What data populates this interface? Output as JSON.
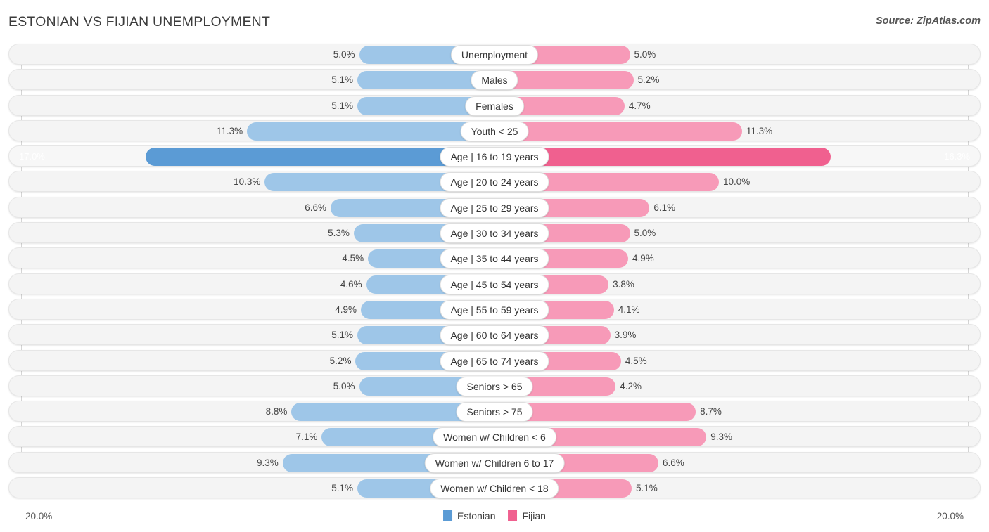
{
  "header": {
    "title": "ESTONIAN VS FIJIAN UNEMPLOYMENT",
    "source": "Source: ZipAtlas.com"
  },
  "footer": {
    "axis_start": "20.0%",
    "axis_end": "20.0%",
    "legend": [
      {
        "label": "Estonian",
        "color": "#5b9bd5"
      },
      {
        "label": "Fijian",
        "color": "#f0608f"
      }
    ]
  },
  "colors": {
    "left_bar": "#9ec6e8",
    "right_bar": "#f79ab8",
    "left_bar_highlight": "#5b9bd5",
    "right_bar_highlight": "#f0608f",
    "row_track": "#f4f4f4",
    "gridline": "#d5d5d5"
  },
  "chart_data": {
    "type": "bar",
    "title": "ESTONIAN VS FIJIAN UNEMPLOYMENT",
    "subtitle": "",
    "xlabel": "",
    "ylabel": "",
    "orientation": "horizontal-diverging",
    "axis_max": 20.0,
    "axis_unit": "%",
    "grid": true,
    "legend_position": "bottom-center",
    "categories": [
      "Unemployment",
      "Males",
      "Females",
      "Youth < 25",
      "Age | 16 to 19 years",
      "Age | 20 to 24 years",
      "Age | 25 to 29 years",
      "Age | 30 to 34 years",
      "Age | 35 to 44 years",
      "Age | 45 to 54 years",
      "Age | 55 to 59 years",
      "Age | 60 to 64 years",
      "Age | 65 to 74 years",
      "Seniors > 65",
      "Seniors > 75",
      "Women w/ Children < 6",
      "Women w/ Children 6 to 17",
      "Women w/ Children < 18"
    ],
    "series": [
      {
        "name": "Estonian",
        "side": "left",
        "color": "#9ec6e8",
        "values": [
          5.0,
          5.1,
          5.1,
          11.3,
          17.0,
          10.3,
          6.6,
          5.3,
          4.5,
          4.6,
          4.9,
          5.1,
          5.2,
          5.0,
          8.8,
          7.1,
          9.3,
          5.1
        ],
        "labels": [
          "5.0%",
          "5.1%",
          "5.1%",
          "11.3%",
          "17.0%",
          "10.3%",
          "6.6%",
          "5.3%",
          "4.5%",
          "4.6%",
          "4.9%",
          "5.1%",
          "5.2%",
          "5.0%",
          "8.8%",
          "7.1%",
          "9.3%",
          "5.1%"
        ]
      },
      {
        "name": "Fijian",
        "side": "right",
        "color": "#f79ab8",
        "values": [
          5.0,
          5.2,
          4.7,
          11.3,
          16.3,
          10.0,
          6.1,
          5.0,
          4.9,
          3.8,
          4.1,
          3.9,
          4.5,
          4.2,
          8.7,
          9.3,
          6.6,
          5.1
        ],
        "labels": [
          "5.0%",
          "5.2%",
          "4.7%",
          "11.3%",
          "16.3%",
          "10.0%",
          "6.1%",
          "5.0%",
          "4.9%",
          "3.8%",
          "4.1%",
          "3.9%",
          "4.5%",
          "4.2%",
          "8.7%",
          "9.3%",
          "6.6%",
          "5.1%"
        ]
      }
    ],
    "highlighted_row": "Age | 16 to 19 years"
  }
}
